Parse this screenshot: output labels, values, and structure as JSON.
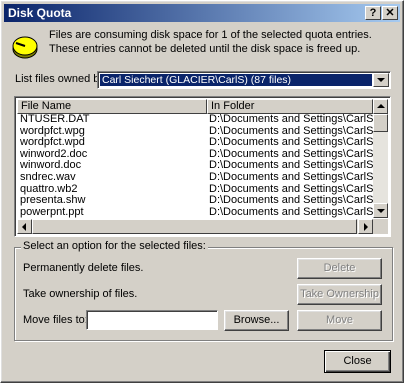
{
  "window": {
    "title": "Disk Quota",
    "help_button": "?",
    "close_button": "✕"
  },
  "message": "Files are consuming disk space for 1 of the selected quota entries.  These entries cannot be deleted until the disk space is freed up.",
  "owner": {
    "label": "List files owned by:",
    "selected": "Carl Siechert (GLACIER\\CarlS) (87 files)"
  },
  "files": {
    "columns": [
      "File Name",
      "In Folder"
    ],
    "rows": [
      [
        "NTUSER.DAT",
        "D:\\Documents and Settings\\CarlS.GLACI"
      ],
      [
        "wordpfct.wpg",
        "D:\\Documents and Settings\\CarlS.GLACI"
      ],
      [
        "wordpfct.wpd",
        "D:\\Documents and Settings\\CarlS.GLACI"
      ],
      [
        "winword2.doc",
        "D:\\Documents and Settings\\CarlS.GLACI"
      ],
      [
        "winword.doc",
        "D:\\Documents and Settings\\CarlS.GLACI"
      ],
      [
        "sndrec.wav",
        "D:\\Documents and Settings\\CarlS.GLACI"
      ],
      [
        "quattro.wb2",
        "D:\\Documents and Settings\\CarlS.GLACI"
      ],
      [
        "presenta.shw",
        "D:\\Documents and Settings\\CarlS.GLACI"
      ],
      [
        "powerpnt.ppt",
        "D:\\Documents and Settings\\CarlS.GLACI"
      ]
    ]
  },
  "options": {
    "group_title": "Select an option for the selected files:",
    "delete_label": "Permanently delete files.",
    "delete_button": "Delete",
    "ownership_label": "Take ownership of files.",
    "ownership_button": "Take Ownership",
    "move_label": "Move files to:",
    "move_value": "",
    "browse_button": "Browse...",
    "move_button": "Move"
  },
  "close_button": "Close"
}
